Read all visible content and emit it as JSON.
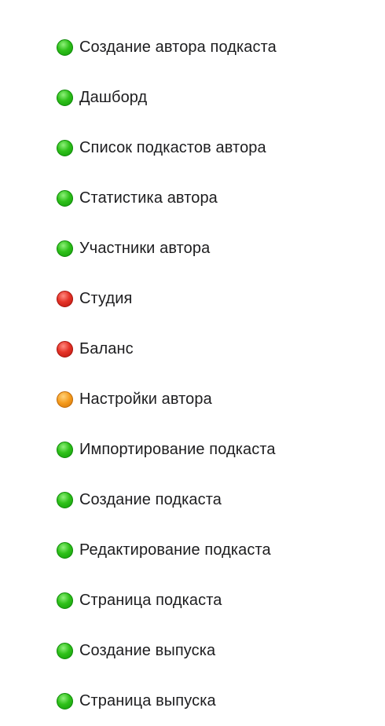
{
  "colors": {
    "green": "#2fc11a",
    "red": "#e53328",
    "orange": "#f49a1c"
  },
  "items": [
    {
      "status": "green",
      "icon": "green-circle-icon",
      "label": "Создание автора подкаста"
    },
    {
      "status": "green",
      "icon": "green-circle-icon",
      "label": "Дашборд"
    },
    {
      "status": "green",
      "icon": "green-circle-icon",
      "label": "Список подкастов автора"
    },
    {
      "status": "green",
      "icon": "green-circle-icon",
      "label": "Статистика автора"
    },
    {
      "status": "green",
      "icon": "green-circle-icon",
      "label": "Участники автора"
    },
    {
      "status": "red",
      "icon": "red-circle-icon",
      "label": "Студия"
    },
    {
      "status": "red",
      "icon": "red-circle-icon",
      "label": "Баланс"
    },
    {
      "status": "orange",
      "icon": "orange-circle-icon",
      "label": "Настройки автора"
    },
    {
      "status": "green",
      "icon": "green-circle-icon",
      "label": "Импортирование подкаста"
    },
    {
      "status": "green",
      "icon": "green-circle-icon",
      "label": "Создание подкаста"
    },
    {
      "status": "green",
      "icon": "green-circle-icon",
      "label": "Редактирование подкаста"
    },
    {
      "status": "green",
      "icon": "green-circle-icon",
      "label": "Страница подкаста"
    },
    {
      "status": "green",
      "icon": "green-circle-icon",
      "label": "Создание выпуска"
    },
    {
      "status": "green",
      "icon": "green-circle-icon",
      "label": "Страница выпуска"
    }
  ]
}
